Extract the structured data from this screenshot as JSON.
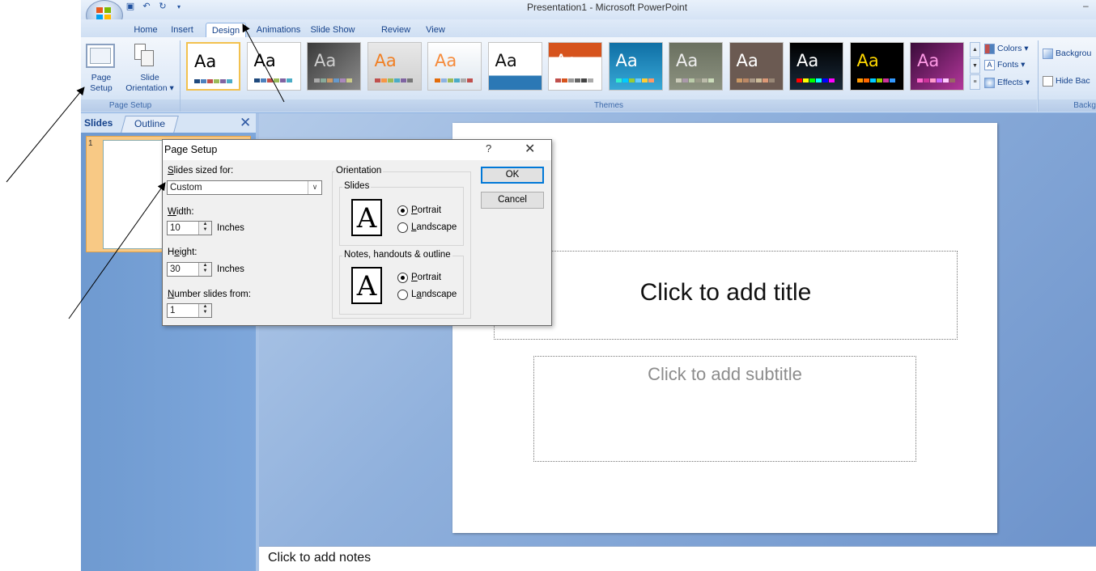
{
  "window": {
    "title": "Presentation1 - Microsoft PowerPoint",
    "minimize": "–"
  },
  "qat": {
    "save_icon": "save-icon",
    "undo_icon": "undo-icon",
    "redo_icon": "redo-icon",
    "customize_icon": "chevron-down-icon"
  },
  "ribbon": {
    "tabs": [
      "Home",
      "Insert",
      "Design",
      "Animations",
      "Slide Show",
      "Review",
      "View"
    ],
    "active_tab": "Design",
    "page_setup_group": {
      "page_setup_label_1": "Page",
      "page_setup_label_2": "Setup",
      "slide_orientation_label_1": "Slide",
      "slide_orientation_label_2": "Orientation ▾",
      "group_label": "Page Setup"
    },
    "themes_group": {
      "group_label": "Themes",
      "theme_sample": "Aa"
    },
    "theme_controls": {
      "colors": "Colors ▾",
      "fonts": "Fonts ▾",
      "effects": "Effects ▾"
    },
    "background_group": {
      "background_styles": "Backgrou",
      "hide_background": "Hide Bac",
      "group_label": "Backg"
    }
  },
  "slides_panel": {
    "tab_slides": "Slides",
    "tab_outline": "Outline",
    "close": "✕",
    "thumb_number": "1"
  },
  "slide": {
    "title_placeholder": "Click to add title",
    "subtitle_placeholder": "Click to add subtitle"
  },
  "notes": {
    "placeholder": "Click to add notes"
  },
  "dialog": {
    "title": "Page Setup",
    "help": "?",
    "close": "✕",
    "sized_for_label_u": "S",
    "sized_for_label_rest": "lides sized for:",
    "sized_for_value": "Custom",
    "width_label_u": "W",
    "width_label_rest": "idth:",
    "width_value": "10",
    "width_unit": "Inches",
    "height_label_pre": "H",
    "height_label_u": "e",
    "height_label_rest": "ight:",
    "height_value": "30",
    "height_unit": "Inches",
    "number_from_label_u": "N",
    "number_from_label_rest": "umber slides from:",
    "number_from_value": "1",
    "orientation_label": "Orientation",
    "slides_label": "Slides",
    "slides_portrait_u": "P",
    "slides_portrait_rest": "ortrait",
    "slides_landscape_u": "L",
    "slides_landscape_rest": "andscape",
    "slides_orientation_selected": "Portrait",
    "notes_label": "Notes, handouts & outline",
    "notes_portrait_u": "P",
    "notes_portrait_rest": "ortrait",
    "notes_landscape_pre": "L",
    "notes_landscape_u": "a",
    "notes_landscape_rest": "ndscape",
    "notes_orientation_selected": "Portrait",
    "orientation_glyph": "A",
    "ok": "OK",
    "cancel": "Cancel"
  }
}
